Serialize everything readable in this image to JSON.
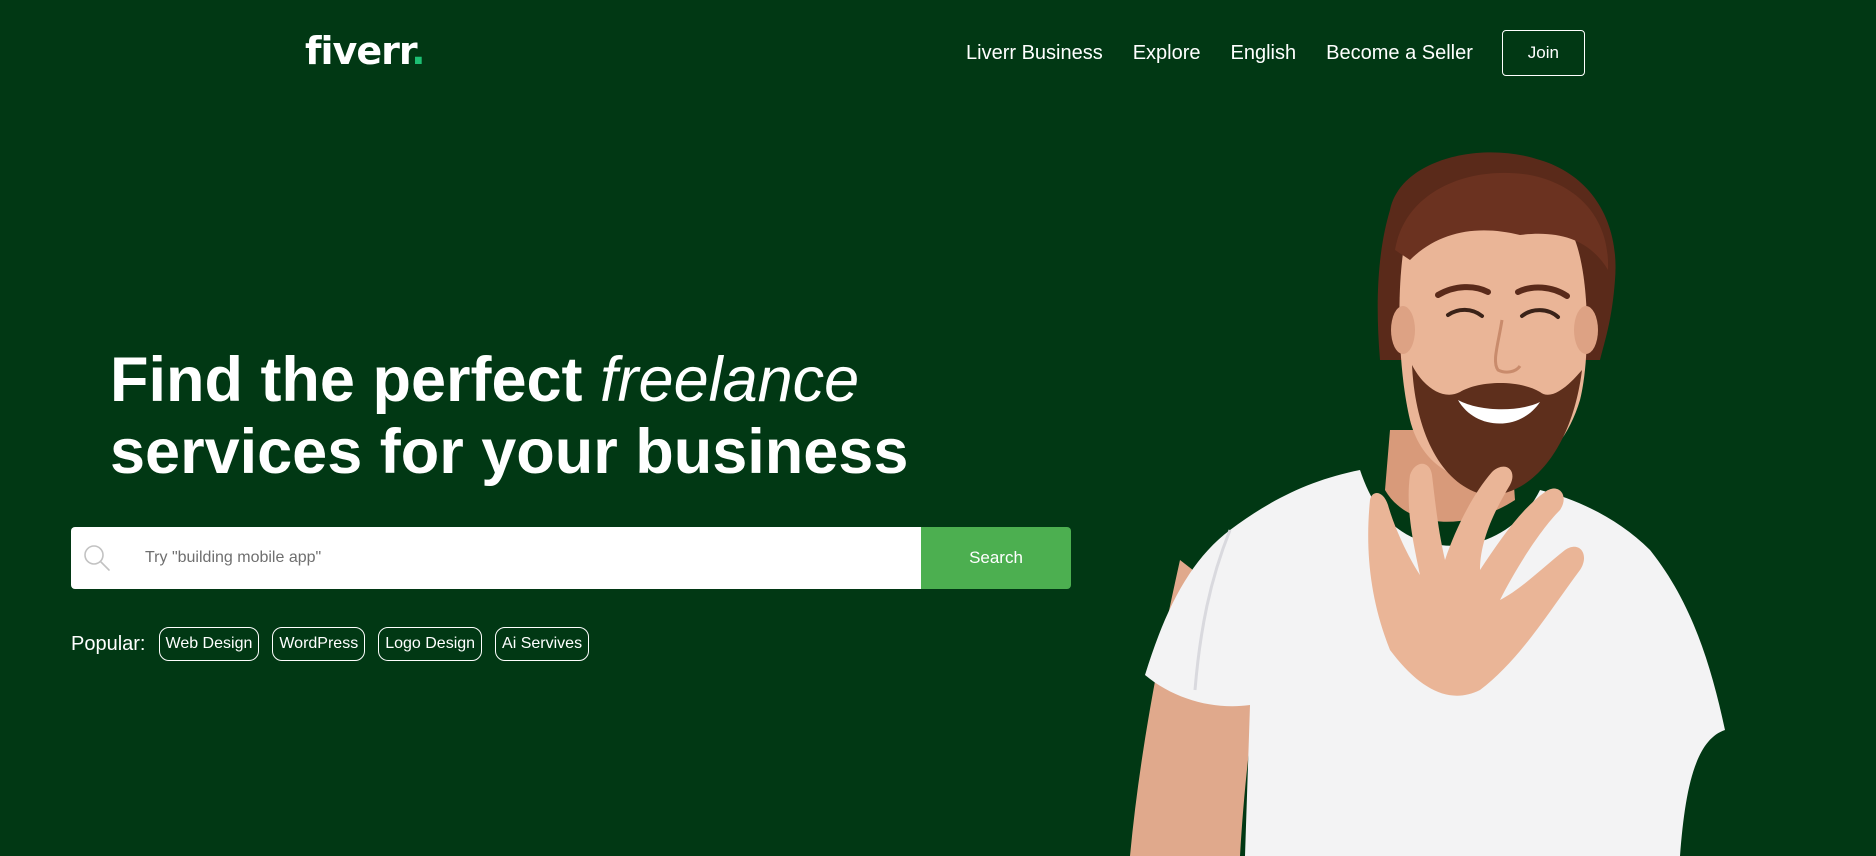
{
  "header": {
    "logo_text": "fiverr",
    "logo_dot": ".",
    "nav": [
      {
        "label": "Liverr Business"
      },
      {
        "label": "Explore"
      },
      {
        "label": "English"
      },
      {
        "label": "Become a Seller"
      }
    ],
    "join_label": "Join"
  },
  "hero": {
    "headline_part1": "Find the perfect ",
    "headline_emphasis": "freelance",
    "headline_line2": "services for your business",
    "search": {
      "placeholder": "Try \"building mobile app\"",
      "value": "",
      "button_label": "Search",
      "icon": "search-icon"
    },
    "popular": {
      "label": "Popular:",
      "tags": [
        "Web Design",
        "WordPress",
        "Logo Design",
        "Ai Servives"
      ]
    },
    "image": "smiling-bearded-man-photo"
  },
  "colors": {
    "background": "#013814",
    "accent_green": "#1dbf73",
    "search_button": "#4caf50",
    "text": "#ffffff"
  }
}
